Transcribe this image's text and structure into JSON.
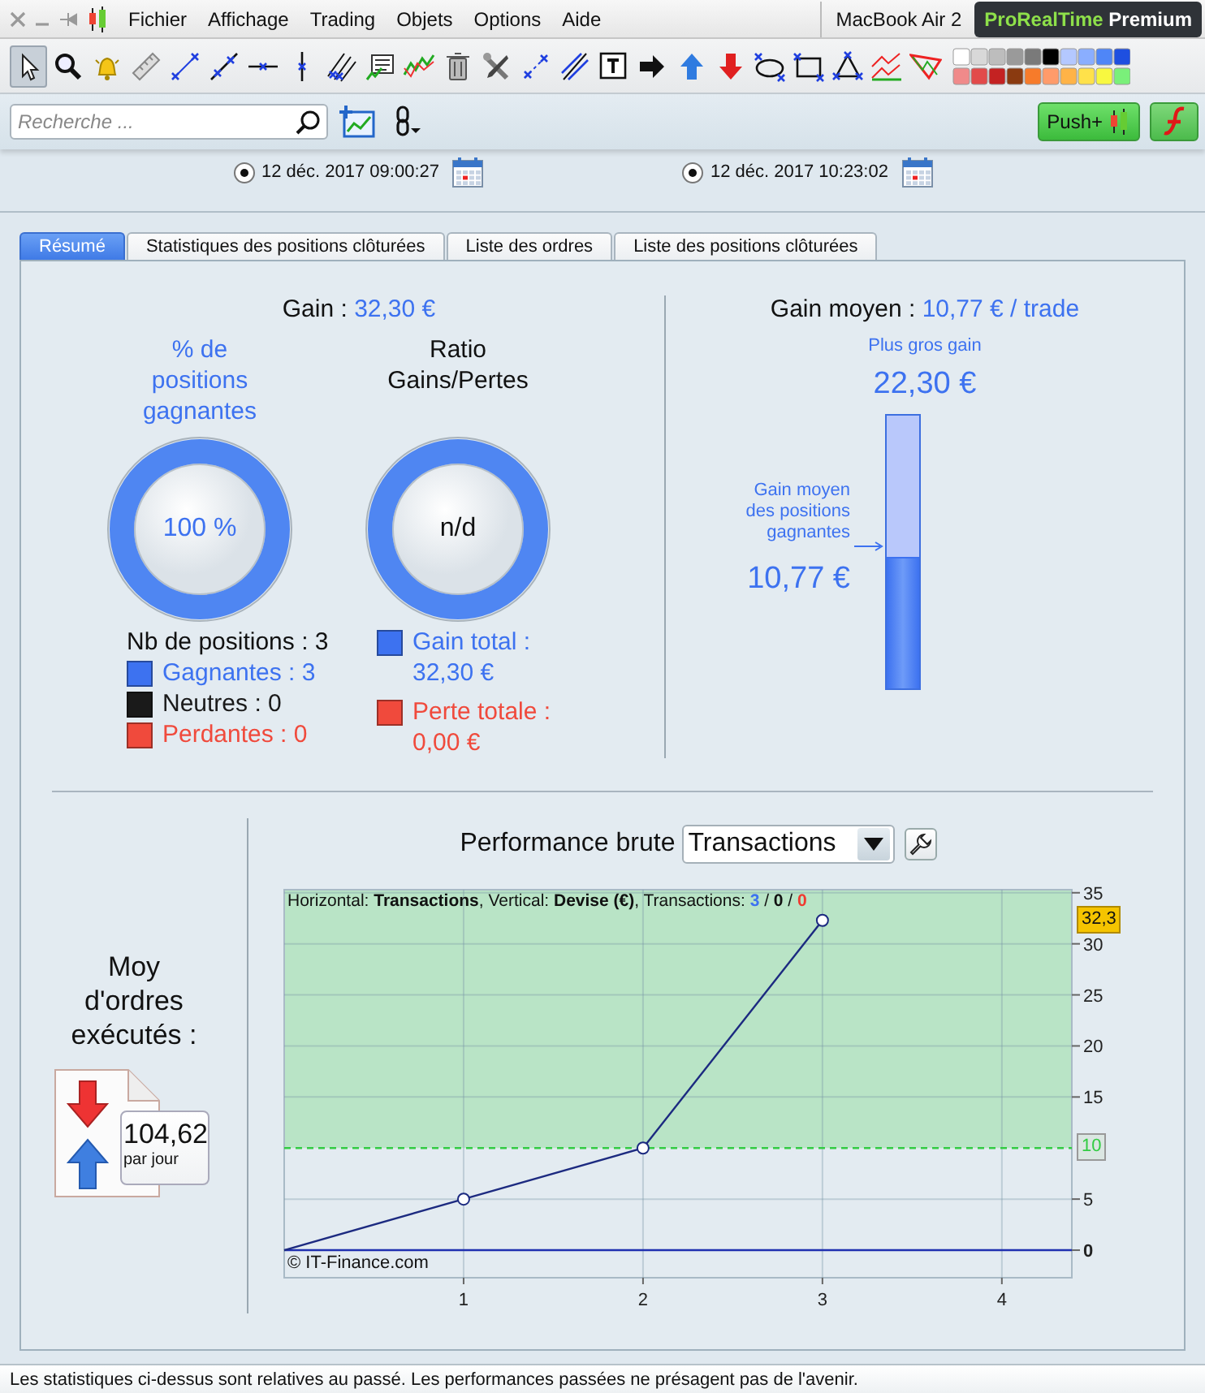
{
  "menu_bar": {
    "menus": [
      {
        "label": "Fichier"
      },
      {
        "label": "Affichage"
      },
      {
        "label": "Trading"
      },
      {
        "label": "Objets"
      },
      {
        "label": "Options"
      },
      {
        "label": "Aide"
      }
    ],
    "device": "MacBook Air 2",
    "product": {
      "brand": "ProRealTime",
      "tier": "Premium"
    }
  },
  "toolbar": {
    "tools": [
      {
        "selected": true
      },
      {
        "selected": false
      },
      {
        "selected": false
      },
      {
        "selected": false
      },
      {
        "selected": false
      },
      {
        "selected": false
      },
      {
        "selected": false
      },
      {
        "selected": false
      },
      {
        "selected": false
      },
      {
        "selected": false
      },
      {
        "selected": false
      },
      {
        "selected": false
      },
      {
        "selected": false
      },
      {
        "selected": false
      },
      {
        "selected": false
      },
      {
        "selected": false
      },
      {
        "selected": false
      },
      {
        "selected": false
      },
      {
        "selected": false
      },
      {
        "selected": false
      },
      {
        "selected": false
      },
      {
        "selected": false
      },
      {
        "selected": false
      },
      {
        "selected": false
      }
    ]
  },
  "search": {
    "placeholder": "Recherche ..."
  },
  "push_button": {
    "label": "Push+"
  },
  "period": [
    {
      "checked": true,
      "date": "12 déc. 2017 09:00:27"
    },
    {
      "checked": true,
      "date": "12 déc. 2017 10:23:02"
    }
  ],
  "tabs": [
    {
      "label": "Résumé",
      "selected": true
    },
    {
      "label": "Statistiques des positions clôturées",
      "selected": false
    },
    {
      "label": "Liste des ordres",
      "selected": false
    },
    {
      "label": "Liste des positions clôturées",
      "selected": false
    }
  ],
  "summary": {
    "gain": {
      "label": "Gain : ",
      "value": "32,30 €"
    },
    "gauges": [
      {
        "kind": "percent",
        "title": "% de positions gagnantes",
        "value": "100 %",
        "level": 1,
        "total": "Nb de positions : 3",
        "legend": [
          {
            "label": "Gagnantes : 3",
            "color": "#3d72f0"
          },
          {
            "label": "Neutres : 0",
            "color": "#1a1a1a"
          },
          {
            "label": "Perdantes : 0",
            "color": "#f04a3c"
          }
        ]
      },
      {
        "kind": "ratio",
        "title": "Ratio Gains/Pertes",
        "value": "n/d",
        "level": 1,
        "legend": [
          {
            "label": "Gain total : 32,30 €",
            "color": "#3d72f0"
          },
          {
            "label": "Perte totale : 0,00 €",
            "color": "#f04a3c"
          }
        ]
      }
    ],
    "average_gain": {
      "label": "Gain moyen : ",
      "value": "10,77 € / trade"
    },
    "max_gain": {
      "label": "Plus gros gain",
      "value": "22,30 €"
    },
    "average_winning": {
      "label": "Gain moyen des positions gagnantes",
      "value": "10,77 €",
      "level": 0.483
    }
  },
  "orders": {
    "label": "Moy d'ordres exécutés :",
    "value": "104,62",
    "unit": "par jour"
  },
  "performance": {
    "title": "Performance brute",
    "selector": {
      "value": "Transactions"
    },
    "chart_header": "Horizontal: **Transactions**, Vertical: **Devise (€)**, Transactions: ",
    "credit": "© IT-Finance.com",
    "counts": [
      {
        "text": "3",
        "color": "#3d72f0"
      },
      {
        "text": "0",
        "color": "#111111"
      },
      {
        "text": "0",
        "color": "#f03a30"
      }
    ],
    "count_separator": " / ",
    "chart_data": {
      "type": "line",
      "x": [
        0,
        1,
        2,
        3
      ],
      "series": [
        {
          "color": "#1c2a80",
          "values": [
            0,
            5,
            10,
            32.3
          ]
        }
      ],
      "xlim": [
        0,
        4.39
      ],
      "ylim": [
        -2.7,
        35.3
      ],
      "xticks": [
        1,
        2,
        3,
        4
      ],
      "yticks": [
        0,
        5,
        15,
        20,
        25,
        30,
        35
      ],
      "grid": true,
      "ref_lines": [
        {
          "axis": "y",
          "value": 10,
          "label": "10",
          "color": "#33cc44"
        },
        {
          "axis": "y",
          "value": 0,
          "color": "#1f2fb0"
        }
      ],
      "bands": [
        {
          "axis": "y",
          "from": 10,
          "to": 35.3,
          "color": "#b9e4c6"
        }
      ],
      "annotations": [
        "32,3"
      ]
    }
  },
  "status_bar": "Les statistiques ci-dessus sont relatives au passé. Les performances passées ne présagent pas de l'avenir."
}
